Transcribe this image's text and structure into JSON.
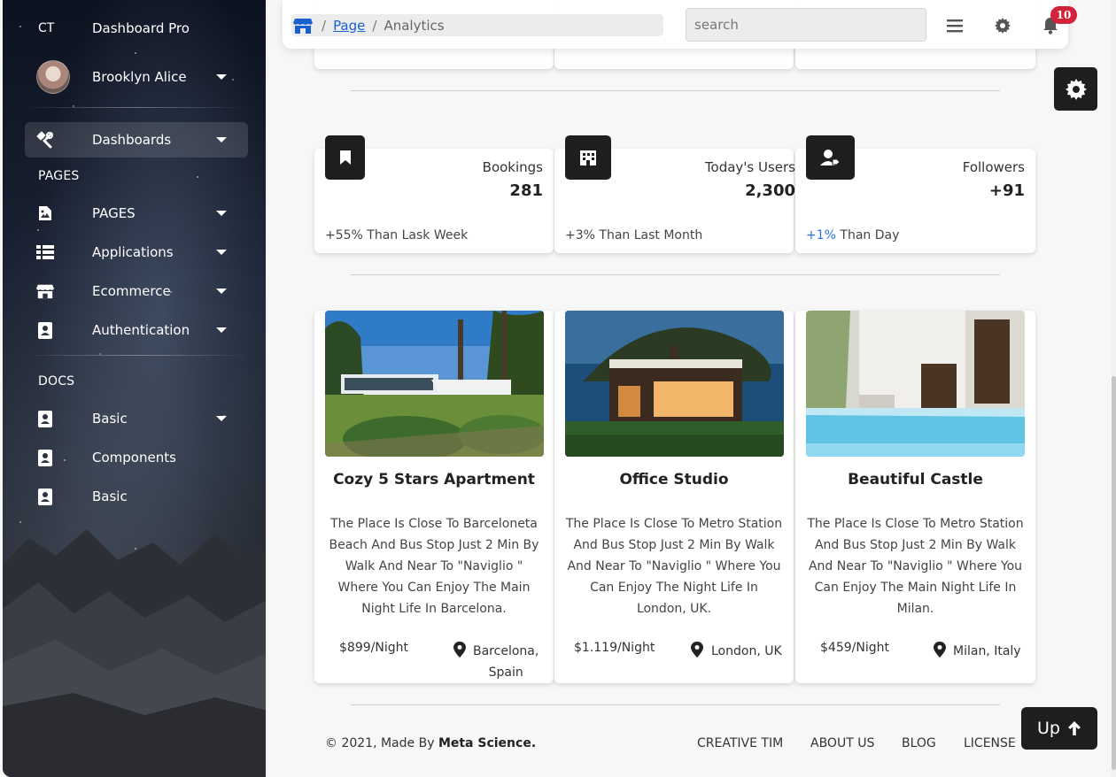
{
  "sidebar": {
    "brand_short": "CT",
    "brand_name": "Dashboard Pro",
    "user_name": "Brooklyn Alice",
    "active_item": "Dashboards",
    "section_pages": "PAGES",
    "pages_items": [
      "PAGES",
      "Applications",
      "Ecommerce",
      "Authentication"
    ],
    "section_docs": "DOCS",
    "docs_items": [
      "Basic",
      "Components",
      "Basic"
    ]
  },
  "navbar": {
    "breadcrumb_page": "Page",
    "breadcrumb_separator": "/",
    "breadcrumb_current": "Analytics",
    "search_placeholder": "search",
    "notification_count": "10"
  },
  "stats": [
    {
      "label": "Bookings",
      "value": "281",
      "foot_accent": "",
      "foot_text": "+55% Than Lask Week",
      "icon": "bookmark-icon"
    },
    {
      "label": "Today's Users",
      "value": "2,300",
      "foot_accent": "",
      "foot_text": "+3% Than Last Month",
      "icon": "building-icon"
    },
    {
      "label": "Followers",
      "value": "+91",
      "foot_accent": "+1%",
      "foot_text": " Than Day",
      "icon": "user-tag-icon"
    }
  ],
  "properties": [
    {
      "title": "Cozy 5 Stars Apartment",
      "description": "The Place Is Close To Barceloneta Beach And Bus Stop Just 2 Min By Walk And Near To \"Naviglio \" Where You Can Enjoy The Main Night Life In Barcelona.",
      "price": "$899/Night",
      "location_line1": "Barcelona,",
      "location_line2": "Spain"
    },
    {
      "title": "Office Studio",
      "description": "The Place Is Close To Metro Station And Bus Stop Just 2 Min By Walk And Near To \"Naviglio \" Where You Can Enjoy The Night Life In London, UK.",
      "price": "$1.119/Night",
      "location_line1": "London, UK",
      "location_line2": ""
    },
    {
      "title": "Beautiful Castle",
      "description": "The Place Is Close To Metro Station And Bus Stop Just 2 Min By Walk And Near To \"Naviglio \" Where You Can Enjoy The Main Night Life In Milan.",
      "price": "$459/Night",
      "location_line1": "Milan, Italy",
      "location_line2": ""
    }
  ],
  "footer": {
    "copyright": "© 2021, Made By",
    "brand": "Meta Science.",
    "links": [
      "CREATIVE TIM",
      "ABOUT US",
      "BLOG",
      "LICENSE"
    ]
  },
  "up_button": {
    "label": "Up"
  },
  "colors": {
    "accent": "#2a73dd",
    "badge": "#d2233b",
    "dark": "#1e1e1e"
  }
}
